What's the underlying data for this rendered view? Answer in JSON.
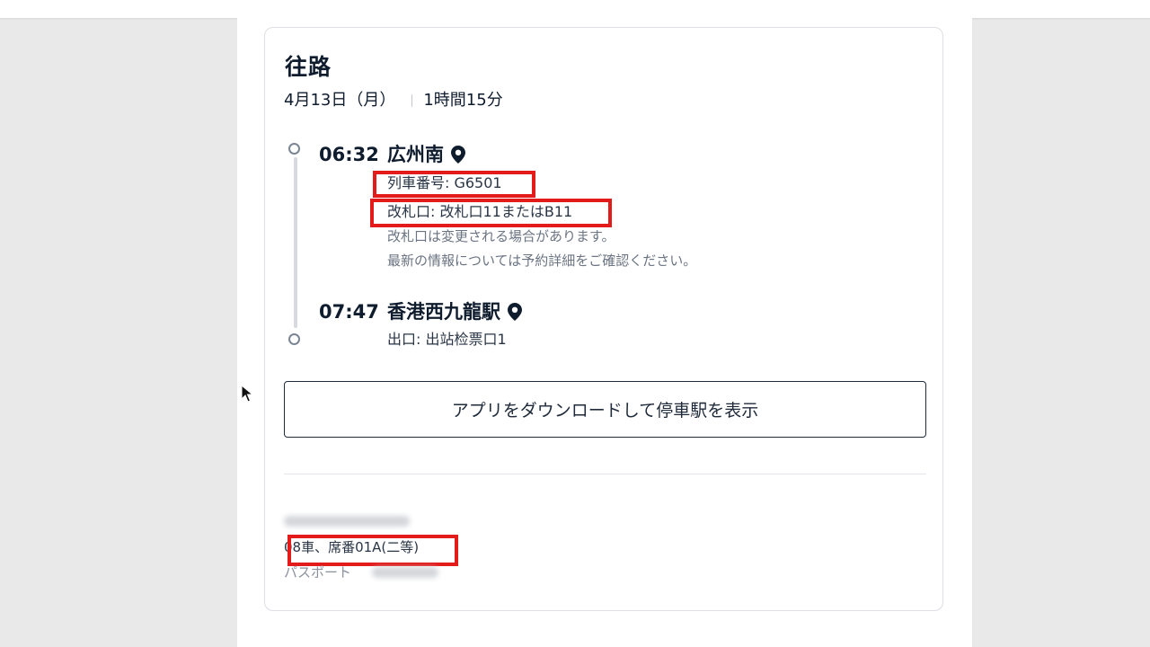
{
  "outbound": {
    "title": "往路",
    "date": "4月13日（月）",
    "duration": "1時間15分",
    "departure": {
      "time": "06:32",
      "station": "広州南",
      "train_number": "列車番号: G6501",
      "gate": "改札口: 改札口11またはB11",
      "note_line1": "改札口は変更される場合があります。",
      "note_line2": "最新の情報については予約詳細をご確認ください。"
    },
    "arrival": {
      "time": "07:47",
      "station": "香港西九龍駅",
      "exit": "出口: 出站检票口1"
    },
    "app_button_label": "アプリをダウンロードして停車駅を表示"
  },
  "passenger": {
    "seat": "08車、席番01A(二等)",
    "passport_label": "パスポート"
  },
  "colors": {
    "highlight": "#e31b1b",
    "text_primary": "#0f1c2e",
    "text_muted": "#6b7482",
    "page_background": "#e9e9e9"
  }
}
